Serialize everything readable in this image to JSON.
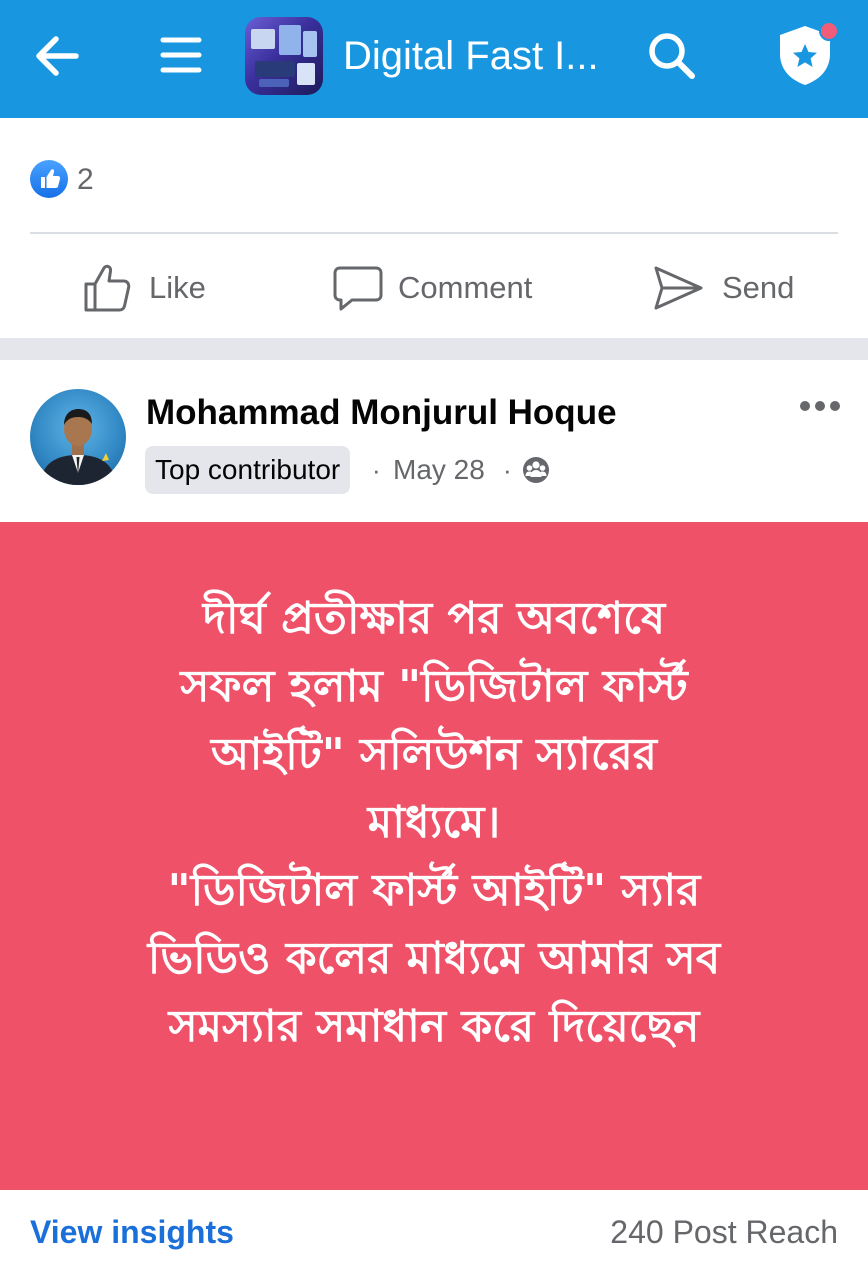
{
  "topbar": {
    "title": "Digital Fast I...",
    "icons": {
      "back": "arrow-left-icon",
      "menu": "hamburger-menu-icon",
      "search": "search-icon",
      "shield": "shield-star-icon"
    },
    "background": "#1897e0"
  },
  "reactions": {
    "count": "2",
    "icon": "like-reaction-icon"
  },
  "actions": {
    "like_label": "Like",
    "comment_label": "Comment",
    "send_label": "Send"
  },
  "post": {
    "author": "Mohammad Monjurul Hoque",
    "badge": "Top contributor",
    "separator": "·",
    "date": "May 28",
    "privacy_icon": "group-privacy-icon",
    "background": "#ef5168",
    "text_lines": [
      "দীর্ঘ প্রতীক্ষার পর অবশেষে",
      "সফল হলাম \"ডিজিটাল ফার্স্ট",
      "আইটি\" সলিউশন স্যারের",
      "মাধ্যমে।",
      "\"ডিজিটাল ফার্স্ট আইটি\" স্যার",
      "ভিডিও কলের মাধ্যমে আমার সব",
      "সমস্যার সমাধান করে দিয়েছেন"
    ]
  },
  "footer": {
    "insights_label": "View insights",
    "reach_text": "240 Post Reach"
  }
}
